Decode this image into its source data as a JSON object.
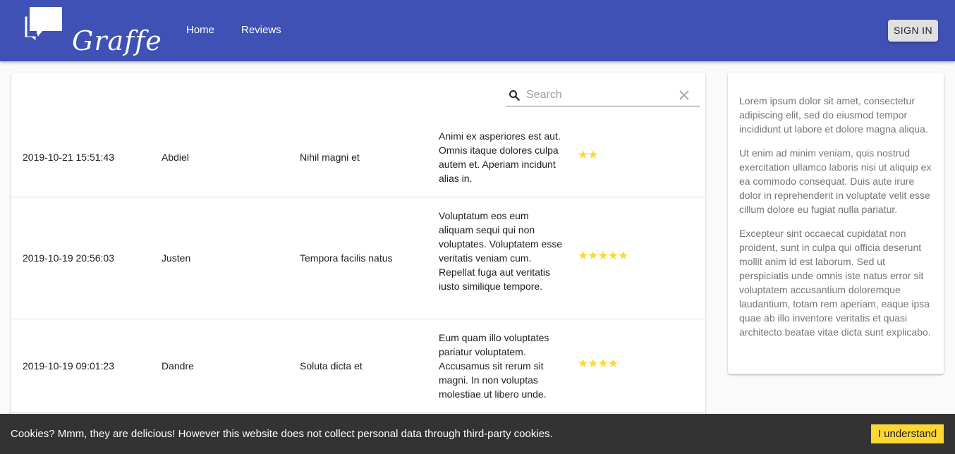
{
  "header": {
    "logo_text": "Graffe",
    "nav": {
      "home": "Home",
      "reviews": "Reviews"
    },
    "signin_label": "SIGN IN"
  },
  "search": {
    "placeholder": "Search",
    "value": ""
  },
  "reviews": [
    {
      "date": "2019-10-21 15:51:43",
      "name": "Abdiel",
      "title": "Nihil magni et",
      "body": "Animi ex asperiores est aut. Omnis itaque dolores culpa autem et. Aperiam incidunt alias in.",
      "rating": 2,
      "stars": "★★"
    },
    {
      "date": "2019-10-19 20:56:03",
      "name": "Justen",
      "title": "Tempora facilis natus",
      "body": "Voluptatum eos eum aliquam sequi qui non voluptates. Voluptatem esse veritatis veniam cum. Repellat fuga aut veritatis iusto similique tempore.",
      "rating": 5,
      "stars": "★★★★★"
    },
    {
      "date": "2019-10-19 09:01:23",
      "name": "Dandre",
      "title": "Soluta dicta et",
      "body": "Eum quam illo voluptates pariatur voluptatem. Accusamus sit rerum sit magni. In non voluptas molestiae ut libero unde.",
      "rating": 4,
      "stars": "★★★★"
    }
  ],
  "sidebar": {
    "paragraphs": [
      "Lorem ipsum dolor sit amet, consectetur adipiscing elit, sed do eiusmod tempor incididunt ut labore et dolore magna aliqua.",
      "Ut enim ad minim veniam, quis nostrud exercitation ullamco laboris nisi ut aliquip ex ea commodo consequat. Duis aute irure dolor in reprehenderit in voluptate velit esse cillum dolore eu fugiat nulla pariatur.",
      "Excepteur sint occaecat cupidatat non proident, sunt in culpa qui officia deserunt mollit anim id est laborum. Sed ut perspiciatis unde omnis iste natus error sit voluptatem accusantium doloremque laudantium, totam rem aperiam, eaque ipsa quae ab illo inventore veritatis et quasi architecto beatae vitae dicta sunt explicabo."
    ]
  },
  "cookie": {
    "message": "Cookies? Mmm, they are delicious! However this website does not collect personal data through third-party cookies.",
    "button_label": "I understand"
  },
  "colors": {
    "primary": "#3f51b5",
    "star": "#fdd835",
    "cookie_bg": "#333333",
    "cookie_button": "#fdd835"
  },
  "icons": {
    "search": "search-icon",
    "clear": "close-icon",
    "logo": "speech-bubble-logo-icon"
  }
}
